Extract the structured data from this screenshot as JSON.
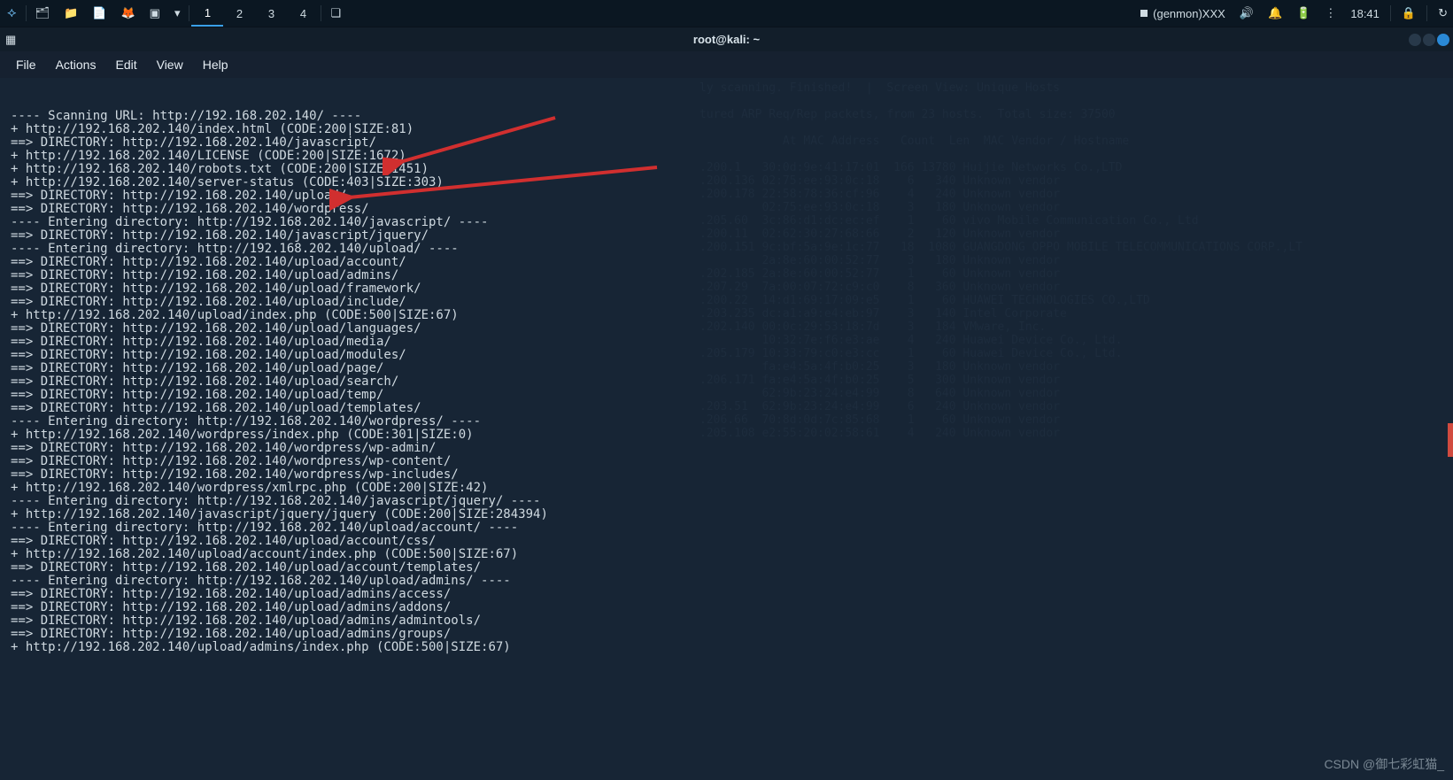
{
  "taskbar": {
    "kali_logo": "⟡",
    "files_icon": "🗂",
    "folder_icon": "📁",
    "doc_icon": "📄",
    "firefox_icon": "🦊",
    "term_icon": "▣",
    "chevron": "▾",
    "ws1": "1",
    "ws2": "2",
    "ws3": "3",
    "ws4": "4",
    "screens_icon": "❏",
    "genmon": "(genmon)XXX",
    "volume_icon": "🔊",
    "bell_icon": "🔔",
    "battery_icon": "🔋",
    "more_icon": "⋮",
    "time": "18:41",
    "lock_icon": "🔒",
    "power_icon": "↻"
  },
  "titlebar": {
    "title": "root@kali: ~",
    "new_tab_icon": "▦"
  },
  "menubar": {
    "file": "File",
    "actions": "Actions",
    "edit": "Edit",
    "view": "View",
    "help": "Help"
  },
  "terminal": {
    "lines": [
      "---- Scanning URL: http://192.168.202.140/ ----",
      "+ http://192.168.202.140/index.html (CODE:200|SIZE:81)",
      "==> DIRECTORY: http://192.168.202.140/javascript/",
      "+ http://192.168.202.140/LICENSE (CODE:200|SIZE:1672)",
      "+ http://192.168.202.140/robots.txt (CODE:200|SIZE:1451)",
      "+ http://192.168.202.140/server-status (CODE:403|SIZE:303)",
      "==> DIRECTORY: http://192.168.202.140/upload/",
      "==> DIRECTORY: http://192.168.202.140/wordpress/",
      "",
      "---- Entering directory: http://192.168.202.140/javascript/ ----",
      "==> DIRECTORY: http://192.168.202.140/javascript/jquery/",
      "",
      "---- Entering directory: http://192.168.202.140/upload/ ----",
      "==> DIRECTORY: http://192.168.202.140/upload/account/",
      "==> DIRECTORY: http://192.168.202.140/upload/admins/",
      "==> DIRECTORY: http://192.168.202.140/upload/framework/",
      "==> DIRECTORY: http://192.168.202.140/upload/include/",
      "+ http://192.168.202.140/upload/index.php (CODE:500|SIZE:67)",
      "==> DIRECTORY: http://192.168.202.140/upload/languages/",
      "==> DIRECTORY: http://192.168.202.140/upload/media/",
      "==> DIRECTORY: http://192.168.202.140/upload/modules/",
      "==> DIRECTORY: http://192.168.202.140/upload/page/",
      "==> DIRECTORY: http://192.168.202.140/upload/search/",
      "==> DIRECTORY: http://192.168.202.140/upload/temp/",
      "==> DIRECTORY: http://192.168.202.140/upload/templates/",
      "",
      "---- Entering directory: http://192.168.202.140/wordpress/ ----",
      "+ http://192.168.202.140/wordpress/index.php (CODE:301|SIZE:0)",
      "==> DIRECTORY: http://192.168.202.140/wordpress/wp-admin/",
      "==> DIRECTORY: http://192.168.202.140/wordpress/wp-content/",
      "==> DIRECTORY: http://192.168.202.140/wordpress/wp-includes/",
      "+ http://192.168.202.140/wordpress/xmlrpc.php (CODE:200|SIZE:42)",
      "",
      "---- Entering directory: http://192.168.202.140/javascript/jquery/ ----",
      "+ http://192.168.202.140/javascript/jquery/jquery (CODE:200|SIZE:284394)",
      "",
      "---- Entering directory: http://192.168.202.140/upload/account/ ----",
      "==> DIRECTORY: http://192.168.202.140/upload/account/css/",
      "+ http://192.168.202.140/upload/account/index.php (CODE:500|SIZE:67)",
      "==> DIRECTORY: http://192.168.202.140/upload/account/templates/",
      "",
      "---- Entering directory: http://192.168.202.140/upload/admins/ ----",
      "==> DIRECTORY: http://192.168.202.140/upload/admins/access/",
      "==> DIRECTORY: http://192.168.202.140/upload/admins/addons/",
      "==> DIRECTORY: http://192.168.202.140/upload/admins/admintools/",
      "==> DIRECTORY: http://192.168.202.140/upload/admins/groups/",
      "+ http://192.168.202.140/upload/admins/index.php (CODE:500|SIZE:67)"
    ]
  },
  "watermark": "CSDN @御七彩虹猫_",
  "ghost": "ly scanning. Finished!  |  Screen View: Unique Hosts\n\ntured ARP Req/Rep packets, from 23 hosts.  Total size: 37500\n\n            At MAC Address   Count  Len  MAC Vendor / Hostname\n\n.200.1   30:0d:9e:41:17:01  166 13780 Huijie Networks Co.,LTD\n.200.136 02:75:ee:93:0c:18    6   340 Unknown vendor\n.200.178 22:58:78:36:cf:96    4   240 Unknown vendor\n         02:75:ee:93:0c:18    3   180 Unknown vendor\n.205.60  3c:86:d1:dc:ec:ef    1    60 vivo Mobile Communication Co., Ltd\n.200.11  02:62:30:27:68:66    2   120 Unknown vendor\n.200.151 9c:bf:5a:9e:1c:77   18  1080 GUANGDONG OPPO MOBILE TELECOMMUNICATIONS CORP.,LT\n         2a:8e:60:00:52:77    3   180 Unknown vendor\n.202.185 2a:8e:60:00:52:77    1    60 Unknown vendor\n.207.29  7a:00:07:72:c9:c0    8   360 Unknown vendor\n.200.22  14:d1:69:17:09:e5    1    60 HUAWEI TECHNOLOGIES CO.,LTD\n.203.235 dc:a1:a9:e4:eb:97    3   140 Intel Corporate\n.202.140 00:0c:29:53:18:7d    3   184 VMware, Inc.\n         10:32:7e:f6:e3:ae    4   240 Huawei Device Co., Ltd.\n.205.179 10:33:79:c0:e3:cc    1    60 Huawei Device Co., Ltd.\n         fa:e4:5a:4f:b0:25    3   180 Unknown vendor\n.206.171 fa:e4:5a:4f:b0:25    5   300 Unknown vendor\n         62:9b:23:24:e4:99    8   640 Unknown vendor\n.203.51  62:9b:23:24:e4:99    6   240 Unknown vendor\n.206.66  70:8d:0d:7c:85:68    1    60 Unknown vendor\n.205.108 e2:55:20:02:58:61    4   240 Unknown vendor"
}
